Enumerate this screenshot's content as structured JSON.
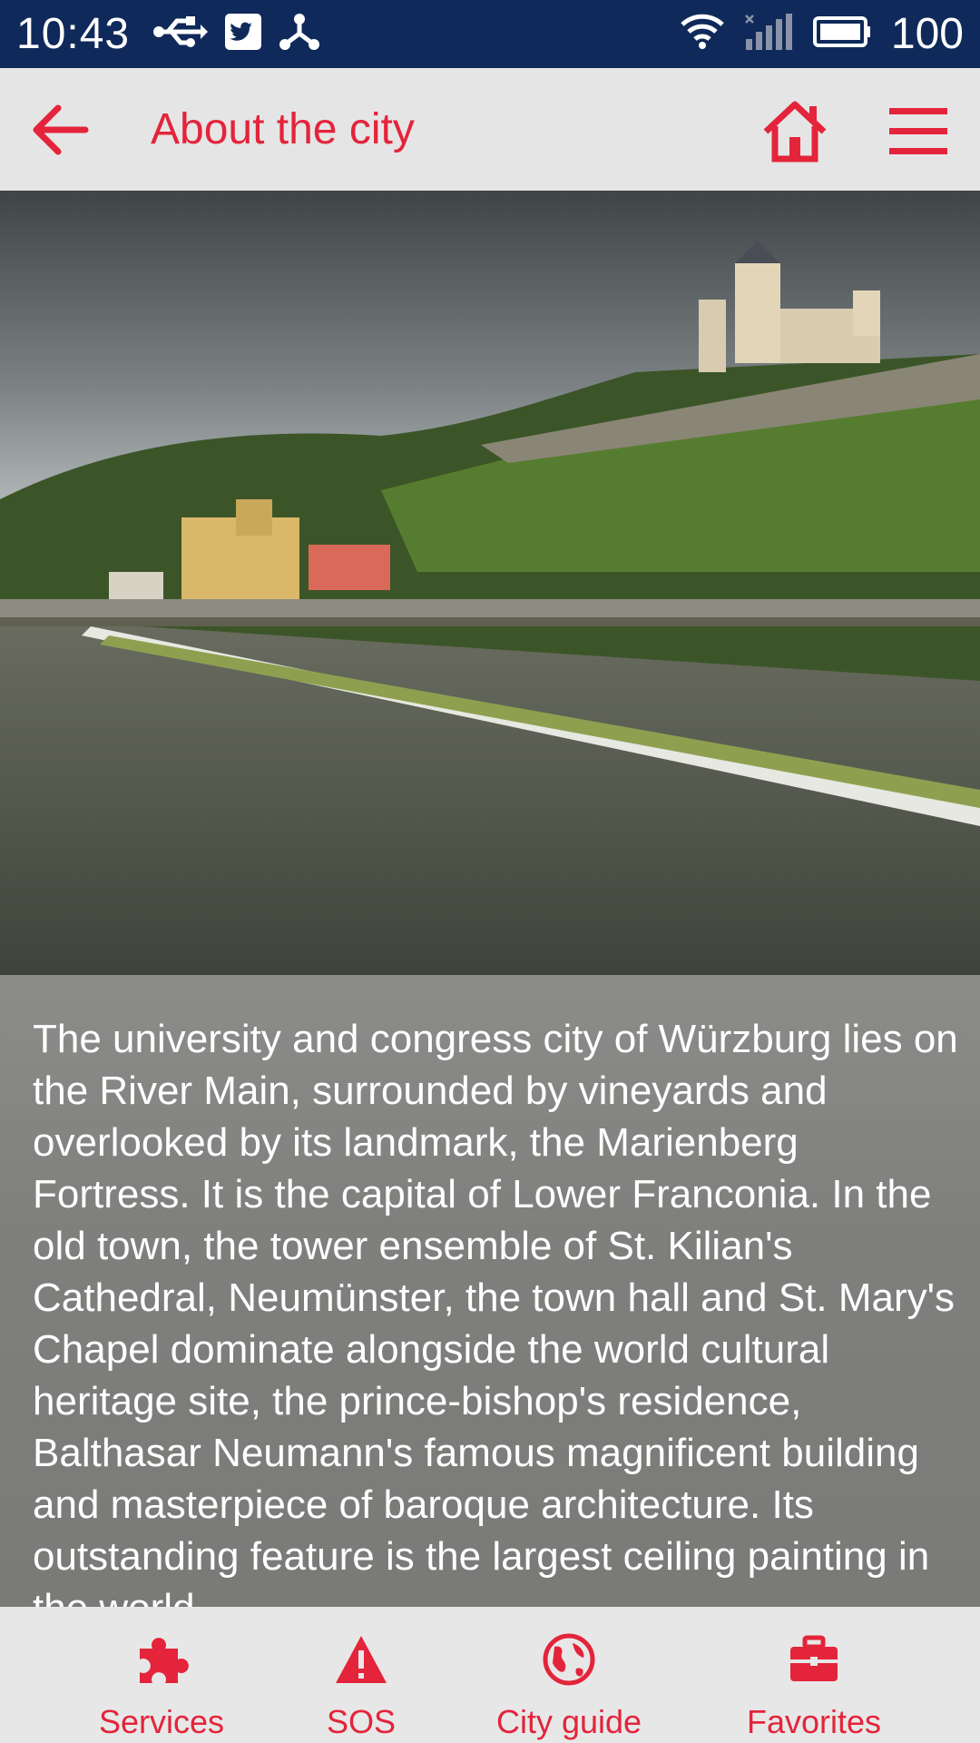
{
  "status_bar": {
    "time": "10:43",
    "battery_level": "100",
    "icons": [
      "usb-icon",
      "twitter-icon",
      "share-icon",
      "wifi-icon",
      "signal-icon",
      "battery-icon"
    ]
  },
  "app_bar": {
    "title": "About the city",
    "icons": [
      "back-arrow-icon",
      "home-icon",
      "menu-icon"
    ]
  },
  "hero": {
    "zoom_icon": "zoom-in-icon"
  },
  "description": {
    "text": "The university and congress city of Würzburg lies on the River Main, surrounded by vineyards and overlooked by its landmark, the Marienberg Fortress. It is the capital of Lower Franconia. In the old town, the tower ensemble of St. Kilian's Cathedral, Neumünster, the town hall and St. Mary's Chapel dominate alongside the world cultural heritage site, the prince-bishop's residence, Balthasar Neumann's famous magnificent building and masterpiece of baroque architecture. Its outstanding feature is the largest ceiling painting in the world"
  },
  "bottom_nav": {
    "items": [
      {
        "label": "Services",
        "icon": "puzzle-icon"
      },
      {
        "label": "SOS",
        "icon": "warning-icon"
      },
      {
        "label": "City guide",
        "icon": "globe-icon"
      },
      {
        "label": "Favorites",
        "icon": "briefcase-icon"
      }
    ]
  },
  "colors": {
    "accent": "#e3243b",
    "status_bar": "#0f2a5a",
    "app_bar": "#e6e5e5",
    "bottom_nav": "#e8e7e7"
  }
}
